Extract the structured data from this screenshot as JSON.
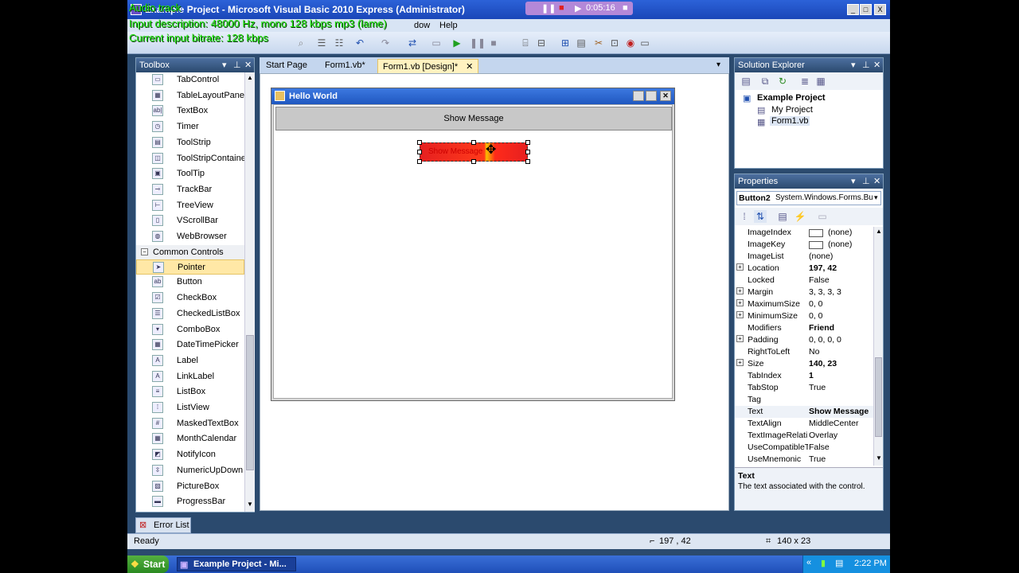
{
  "overlay": {
    "line1": "Audio track",
    "line2": "Input description: 48000 Hz, mono 128 kbps mp3 (lame)",
    "line3": "Current input bitrate: 128 kbps",
    "recorder_time": "0:05:16"
  },
  "window": {
    "title": "Example Project - Microsoft Visual Basic 2010 Express (Administrator)",
    "min_label": "_",
    "max_label": "□",
    "close_label": "X"
  },
  "menu": {
    "visible_items": [
      "dow",
      "Help"
    ]
  },
  "toolbox": {
    "title": "Toolbox",
    "items": [
      {
        "label": "TabControl",
        "icon": "▭"
      },
      {
        "label": "TableLayoutPanel",
        "icon": "▦"
      },
      {
        "label": "TextBox",
        "icon": "ab|"
      },
      {
        "label": "Timer",
        "icon": "◷"
      },
      {
        "label": "ToolStrip",
        "icon": "▤"
      },
      {
        "label": "ToolStripContainer",
        "icon": "◫"
      },
      {
        "label": "ToolTip",
        "icon": "▣"
      },
      {
        "label": "TrackBar",
        "icon": "⊸"
      },
      {
        "label": "TreeView",
        "icon": "⊢"
      },
      {
        "label": "VScrollBar",
        "icon": "▯"
      },
      {
        "label": "WebBrowser",
        "icon": "◍"
      }
    ],
    "group_label": "Common Controls",
    "common_items": [
      {
        "label": "Pointer",
        "icon": "➤",
        "selected": true
      },
      {
        "label": "Button",
        "icon": "ab"
      },
      {
        "label": "CheckBox",
        "icon": "☑"
      },
      {
        "label": "CheckedListBox",
        "icon": "☰"
      },
      {
        "label": "ComboBox",
        "icon": "▾"
      },
      {
        "label": "DateTimePicker",
        "icon": "▦"
      },
      {
        "label": "Label",
        "icon": "A"
      },
      {
        "label": "LinkLabel",
        "icon": "A"
      },
      {
        "label": "ListBox",
        "icon": "≡"
      },
      {
        "label": "ListView",
        "icon": "⁞"
      },
      {
        "label": "MaskedTextBox",
        "icon": "#"
      },
      {
        "label": "MonthCalendar",
        "icon": "▦"
      },
      {
        "label": "NotifyIcon",
        "icon": "◩"
      },
      {
        "label": "NumericUpDown",
        "icon": "⇳"
      },
      {
        "label": "PictureBox",
        "icon": "▨"
      },
      {
        "label": "ProgressBar",
        "icon": "▬"
      }
    ]
  },
  "tabs": [
    {
      "label": "Start Page"
    },
    {
      "label": "Form1.vb*"
    },
    {
      "label": "Form1.vb [Design]*",
      "active": true
    }
  ],
  "designer": {
    "form_title": "Hello World",
    "button1_text": "Show Message",
    "button2_text": "Show Message"
  },
  "solution_explorer": {
    "title": "Solution Explorer",
    "project": "Example Project",
    "nodes": [
      "My Project",
      "Form1.vb"
    ]
  },
  "properties": {
    "title": "Properties",
    "object": "Button2",
    "object_type": "System.Windows.Forms.Butt",
    "rows": [
      {
        "name": "ImageIndex",
        "value": "(none)",
        "expand": false,
        "bold": false
      },
      {
        "name": "ImageKey",
        "value": "(none)",
        "expand": false,
        "bold": false
      },
      {
        "name": "ImageList",
        "value": "(none)",
        "expand": false,
        "bold": false
      },
      {
        "name": "Location",
        "value": "197, 42",
        "expand": true,
        "bold": true
      },
      {
        "name": "Locked",
        "value": "False",
        "expand": false,
        "bold": false
      },
      {
        "name": "Margin",
        "value": "3, 3, 3, 3",
        "expand": true,
        "bold": false
      },
      {
        "name": "MaximumSize",
        "value": "0, 0",
        "expand": true,
        "bold": false
      },
      {
        "name": "MinimumSize",
        "value": "0, 0",
        "expand": true,
        "bold": false
      },
      {
        "name": "Modifiers",
        "value": "Friend",
        "expand": false,
        "bold": true
      },
      {
        "name": "Padding",
        "value": "0, 0, 0, 0",
        "expand": true,
        "bold": false
      },
      {
        "name": "RightToLeft",
        "value": "No",
        "expand": false,
        "bold": false
      },
      {
        "name": "Size",
        "value": "140, 23",
        "expand": true,
        "bold": true
      },
      {
        "name": "TabIndex",
        "value": "1",
        "expand": false,
        "bold": true
      },
      {
        "name": "TabStop",
        "value": "True",
        "expand": false,
        "bold": false
      },
      {
        "name": "Tag",
        "value": "",
        "expand": false,
        "bold": false
      },
      {
        "name": "Text",
        "value": "Show Message",
        "expand": false,
        "bold": true
      },
      {
        "name": "TextAlign",
        "value": "MiddleCenter",
        "expand": false,
        "bold": false
      },
      {
        "name": "TextImageRelati",
        "value": "Overlay",
        "expand": false,
        "bold": false
      },
      {
        "name": "UseCompatibleT",
        "value": "False",
        "expand": false,
        "bold": false
      },
      {
        "name": "UseMnemonic",
        "value": "True",
        "expand": false,
        "bold": false
      }
    ],
    "desc_title": "Text",
    "desc_text": "The text associated with the control."
  },
  "bottom": {
    "error_list": "Error List",
    "status": "Ready",
    "coords": "197 , 42",
    "size": "140 x 23"
  },
  "taskbar": {
    "start": "Start",
    "task": "Example Project - Mi...",
    "clock": "2:22 PM"
  }
}
